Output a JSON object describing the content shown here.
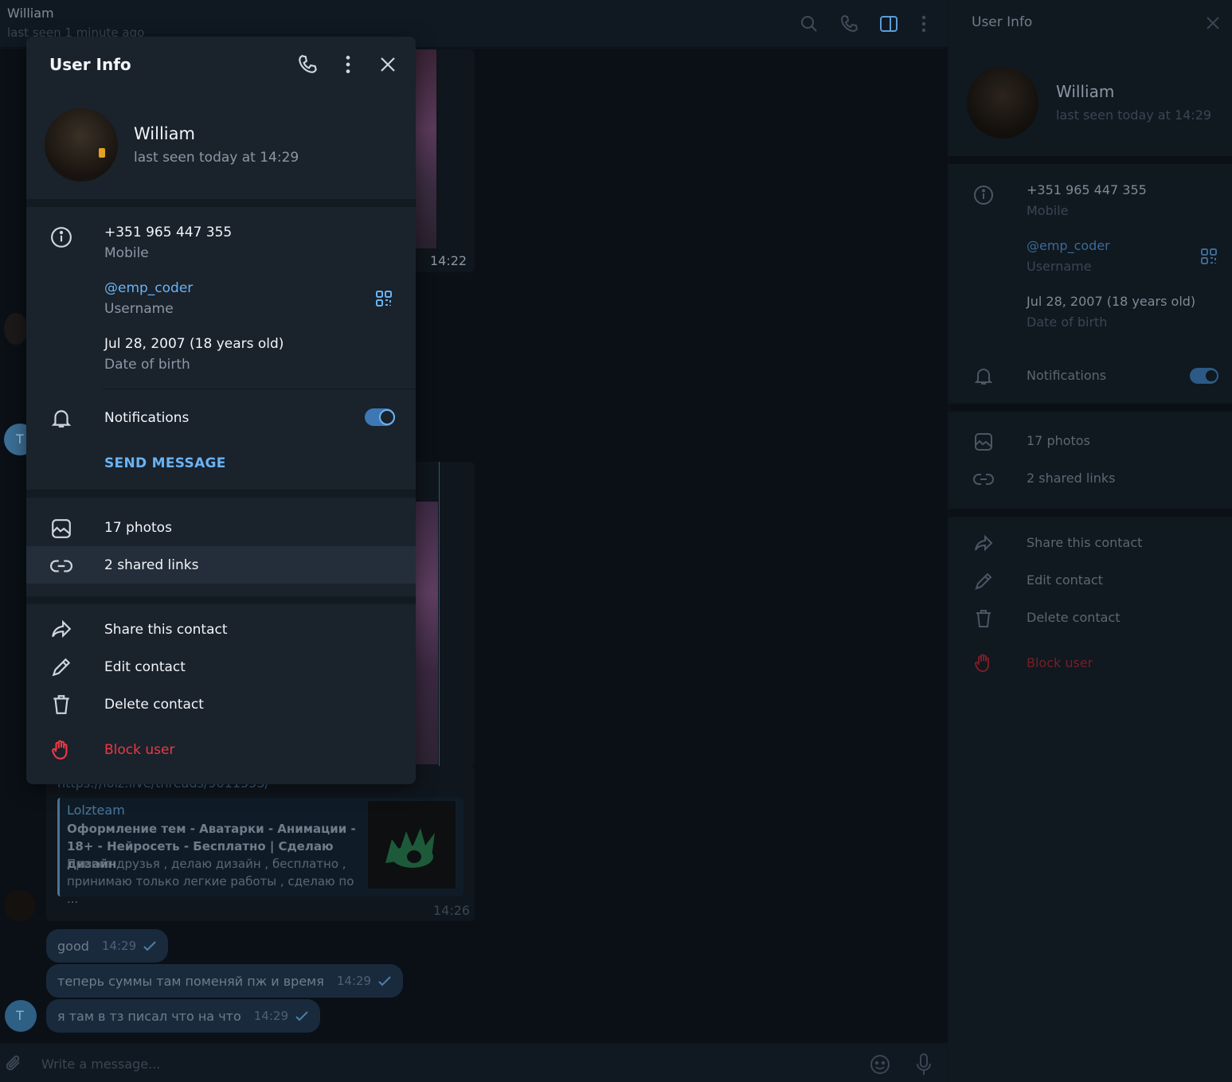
{
  "chat": {
    "name": "William",
    "status": "last seen 1 minute ago",
    "media_time_1": "14:22",
    "link_url": "https://lolz.live/threads/9011553/",
    "link_preview": {
      "site": "Lolzteam",
      "title": "Оформление тем - Аватарки - Анимации - 18+ - Нейросеть - Бесплатно | Сделаю дизайн",
      "description": "Привет друзья , делаю дизайн , бесплатно , принимаю только легкие работы , сделаю по ...",
      "time": "14:26"
    },
    "avatar_letter": "T",
    "messages": [
      {
        "text": "good",
        "time": "14:29"
      },
      {
        "text": "теперь суммы там поменяй пж и время",
        "time": "14:29"
      },
      {
        "text": "я там в тз писал что на что",
        "time": "14:29"
      }
    ],
    "input_placeholder": "Write a message..."
  },
  "right_panel": {
    "title": "User Info",
    "name": "William",
    "status": "last seen today at 14:29",
    "phone": "+351 965 447 355",
    "phone_label": "Mobile",
    "username": "@emp_coder",
    "username_label": "Username",
    "birthday": "Jul 28, 2007 (18 years old)",
    "birthday_label": "Date of birth",
    "notifications": "Notifications",
    "photos": "17 photos",
    "links": "2 shared links",
    "share": "Share this contact",
    "edit": "Edit contact",
    "delete": "Delete contact",
    "block": "Block user"
  },
  "modal": {
    "title": "User Info",
    "name": "William",
    "status": "last seen today at 14:29",
    "phone": "+351 965 447 355",
    "phone_label": "Mobile",
    "username": "@emp_coder",
    "username_label": "Username",
    "birthday": "Jul 28, 2007 (18 years old)",
    "birthday_label": "Date of birth",
    "notifications": "Notifications",
    "notifications_on": true,
    "send_message": "SEND MESSAGE",
    "photos": "17 photos",
    "links": "2 shared links",
    "share": "Share this contact",
    "edit": "Edit contact",
    "delete": "Delete contact",
    "block": "Block user"
  },
  "colors": {
    "accent": "#6ab3f3",
    "danger": "#ec3942",
    "toggle": "#3d78b5"
  }
}
